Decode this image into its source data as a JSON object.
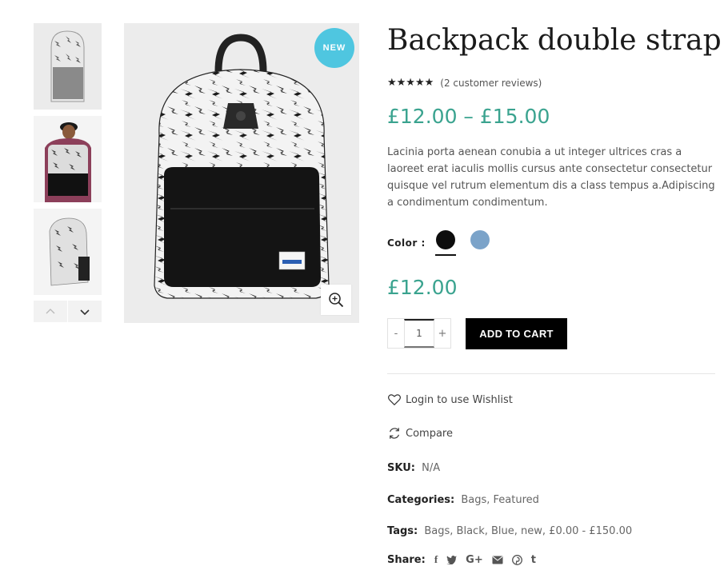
{
  "product": {
    "title": "Backpack double strap",
    "rating_stars": "★★★★★",
    "reviews_text": "(2 customer reviews)",
    "price_range": "£12.00 – £15.00",
    "description": "Lacinia porta aenean conubia a ut integer ultrices cras a laoreet erat iaculis mollis cursus ante consectetur consectetur quisque vel rutrum elementum dis a class tempus a.Adipiscing a condimentum condimentum.",
    "badge": "NEW",
    "price_selected": "£12.00"
  },
  "color": {
    "label": "Color :",
    "swatches": [
      {
        "name": "black",
        "hex": "#0d0d0d",
        "selected": true
      },
      {
        "name": "blue",
        "hex": "#7ba3c9",
        "selected": false
      }
    ]
  },
  "cart": {
    "minus": "-",
    "plus": "+",
    "quantity": "1",
    "add_label": "ADD TO CART"
  },
  "actions": {
    "wishlist": "Login to use Wishlist",
    "compare": "Compare"
  },
  "meta": {
    "sku_label": "SKU:",
    "sku_value": "N/A",
    "categories_label": "Categories:",
    "categories": [
      "Bags",
      "Featured"
    ],
    "tags_label": "Tags:",
    "tags": [
      "Bags",
      "Black",
      "Blue",
      "new",
      "£0.00 - £150.00"
    ],
    "share_label": "Share:"
  },
  "share_icons": [
    "facebook-icon",
    "twitter-icon",
    "google-plus-icon",
    "email-icon",
    "pinterest-icon",
    "tumblr-icon"
  ],
  "colors": {
    "accent_price": "#3aa38f",
    "badge": "#4fc6e0",
    "button": "#000000"
  }
}
